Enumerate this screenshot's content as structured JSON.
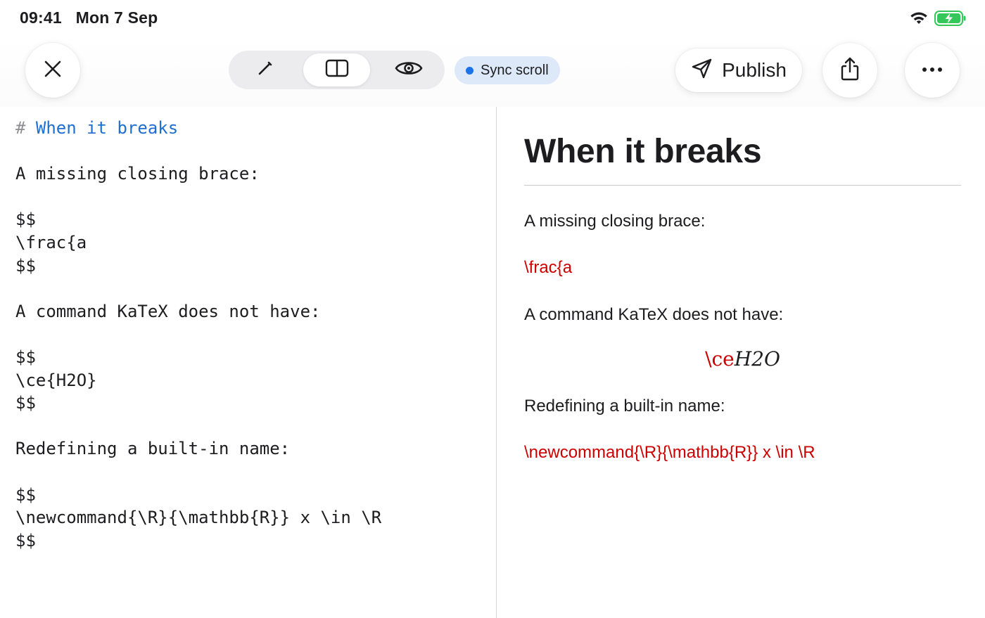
{
  "status_bar": {
    "time": "09:41",
    "date": "Mon 7 Sep",
    "wifi_icon": "wifi-icon",
    "battery_icon": "battery-charging-icon",
    "battery_color": "#34c759"
  },
  "toolbar": {
    "close_icon": "close-icon",
    "view_modes": [
      {
        "name": "edit",
        "icon": "pencil-icon",
        "active": false
      },
      {
        "name": "split",
        "icon": "split-view-icon",
        "active": true
      },
      {
        "name": "preview",
        "icon": "eye-icon",
        "active": false
      }
    ],
    "sync_scroll_label": "Sync scroll",
    "sync_scroll_dot_color": "#1a73e8",
    "publish_label": "Publish",
    "share_icon": "share-icon",
    "more_icon": "more-icon"
  },
  "editor": {
    "heading_marker": "# ",
    "heading_text": "When it breaks",
    "lines": [
      "",
      "A missing closing brace:",
      "",
      "$$",
      "\\frac{a",
      "$$",
      "",
      "A command KaTeX does not have:",
      "",
      "$$",
      "\\ce{H2O}",
      "$$",
      "",
      "Redefining a built-in name:",
      "",
      "$$",
      "\\newcommand{\\R}{\\mathbb{R}} x \\in \\R",
      "$$"
    ]
  },
  "preview": {
    "title": "When it breaks",
    "para1": "A missing closing brace:",
    "error1": "\\frac{a",
    "para2": "A command KaTeX does not have:",
    "math2_cmd": "\\ce",
    "math2_body": "H2O",
    "para3": "Redefining a built-in name:",
    "error3": "\\newcommand{\\R}{\\mathbb{R}} x \\in \\R",
    "error_color": "#cc0000"
  }
}
